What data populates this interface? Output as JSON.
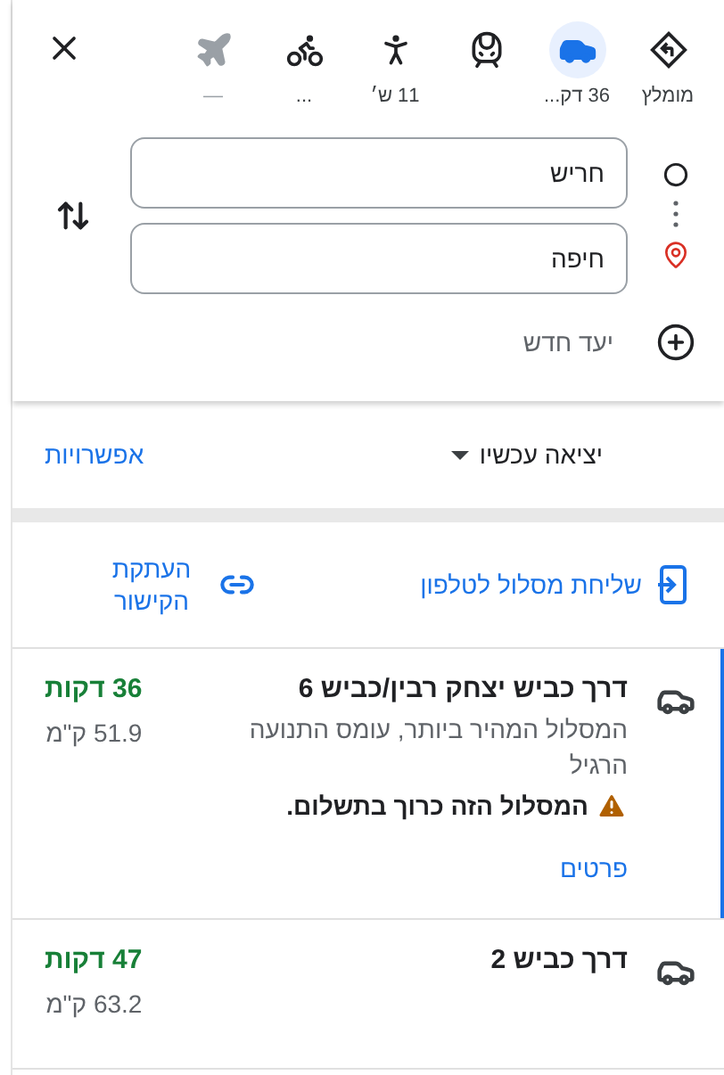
{
  "modes": [
    {
      "kind": "recommended",
      "label": "מומלץ",
      "selected": false,
      "disabled": false
    },
    {
      "kind": "car",
      "label": "36 דק...",
      "selected": true,
      "disabled": false
    },
    {
      "kind": "transit",
      "selected": false,
      "disabled": false
    },
    {
      "kind": "walk",
      "label": "11 ש׳",
      "selected": false,
      "disabled": false
    },
    {
      "kind": "bike",
      "label": "...",
      "selected": false,
      "disabled": false
    },
    {
      "kind": "flight",
      "label": "—",
      "selected": false,
      "disabled": true
    }
  ],
  "origin": {
    "value": "חריש"
  },
  "destination": {
    "value": "חיפה"
  },
  "add_destination": "יעד חדש",
  "departure": "יציאה עכשיו",
  "options": "אפשרויות",
  "send_to_phone": "שליחת מסלול לטלפון",
  "copy_link": "העתקת הקישור",
  "routes": [
    {
      "title": "דרך כביש יצחק רבין/כביש 6",
      "description": "המסלול המהיר ביותר, עומס התנועה הרגיל",
      "warning": "המסלול הזה כרוך בתשלום.",
      "details": "פרטים",
      "duration": "36 דקות",
      "distance": "51.9 ק\"מ",
      "selected": true
    },
    {
      "title": "דרך כביש 2",
      "duration": "47 דקות",
      "distance": "63.2 ק\"מ",
      "selected": false
    }
  ]
}
